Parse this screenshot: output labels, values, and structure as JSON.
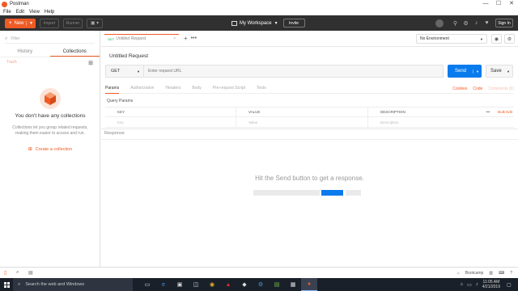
{
  "window": {
    "title": "Postman",
    "minimize": "—",
    "maximize": "☐",
    "close": "✕"
  },
  "menu": [
    "File",
    "Edit",
    "View",
    "Help"
  ],
  "toolbar": {
    "new_label": "New",
    "import_label": "Import",
    "runner_label": "Runner",
    "workspace_label": "My Workspace",
    "invite_label": "Invite",
    "signin_label": "Sign In"
  },
  "sidebar": {
    "filter_placeholder": "Filter",
    "tabs": [
      "History",
      "Collections"
    ],
    "active_tab": "Collections",
    "trash_label": "Trash",
    "empty_title": "You don't have any collections",
    "empty_description": "Collections let you group related requests, making them easier to access and run.",
    "create_link": "Create a collection"
  },
  "request_tab": {
    "method": "GET",
    "name": "Untitled Request"
  },
  "environment": {
    "selected": "No Environment"
  },
  "request": {
    "name": "Untitled Request",
    "method": "GET",
    "url_placeholder": "Enter request URL",
    "send_label": "Send",
    "save_label": "Save"
  },
  "sub_tabs": [
    "Params",
    "Authorization",
    "Headers",
    "Body",
    "Pre-request Script",
    "Tests"
  ],
  "sub_tab_active": "Params",
  "sub_links": {
    "cookies": "Cookies",
    "code": "Code",
    "comments": "Comments (0)"
  },
  "params": {
    "label": "Query Params",
    "headers": {
      "key": "KEY",
      "value": "VALUE",
      "description": "DESCRIPTION"
    },
    "placeholders": {
      "key": "Key",
      "value": "Value",
      "description": "Description"
    },
    "more": "•••",
    "bulk_edit": "Bulk Edit"
  },
  "response": {
    "label": "Response",
    "empty_message": "Hit the Send button to get a response."
  },
  "statusbar": {
    "bootcamp": "Bootcamp"
  },
  "taskbar": {
    "search_placeholder": "Search the web and Windows",
    "time": "11:05 AM",
    "date": "4/21/2019"
  },
  "colors": {
    "accent": "#ef5b25",
    "primary": "#097bed",
    "toolbar_bg": "#303030",
    "taskbar_bg": "#1a2029"
  }
}
